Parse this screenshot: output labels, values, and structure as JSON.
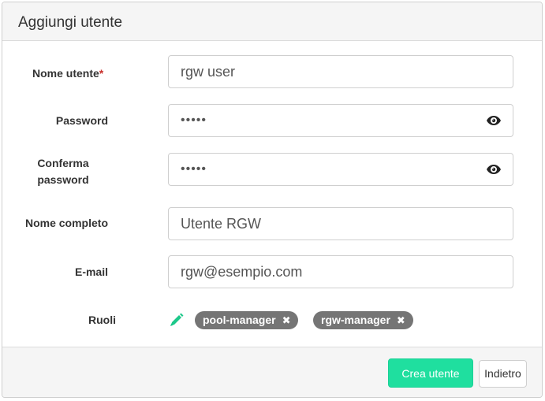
{
  "form": {
    "title": "Aggiungi utente",
    "username": {
      "label": "Nome utente",
      "required_mark": "*",
      "value": "rgw user"
    },
    "password": {
      "label": "Password",
      "value": "•••••",
      "toggle_icon": "eye-icon"
    },
    "confirm_password": {
      "label_line1": "Conferma",
      "label_line2": "password",
      "value": "•••••",
      "toggle_icon": "eye-icon"
    },
    "full_name": {
      "label": "Nome completo",
      "value": "Utente RGW"
    },
    "email": {
      "label": "E-mail",
      "value": "rgw@esempio.com"
    },
    "roles": {
      "label": "Ruoli",
      "edit_icon": "pencil-icon",
      "items": [
        {
          "name": "pool-manager",
          "remove_icon": "times-icon"
        },
        {
          "name": "rgw-manager",
          "remove_icon": "times-icon"
        }
      ]
    }
  },
  "footer": {
    "submit_label": "Crea utente",
    "back_label": "Indietro"
  },
  "colors": {
    "primary_button": "#1fdf9f",
    "badge": "#757575",
    "pencil": "#1cc88a",
    "required": "#c9302c"
  }
}
